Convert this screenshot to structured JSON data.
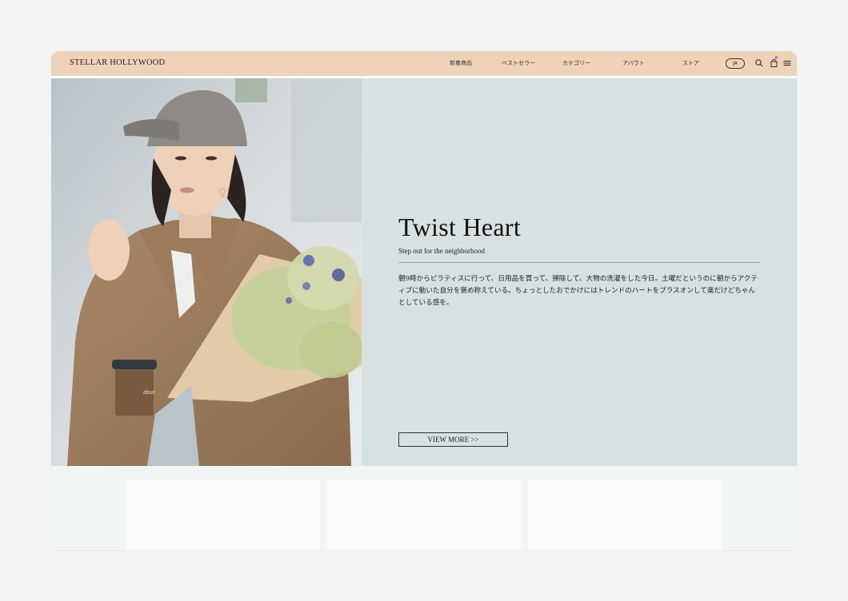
{
  "header": {
    "brand": "STELLAR HOLLYWOOD",
    "nav": [
      {
        "label": "新着商品"
      },
      {
        "label": "ベストセラー"
      },
      {
        "label": "カテゴリー"
      },
      {
        "label": "アバウト"
      },
      {
        "label": "ストア"
      }
    ],
    "language": "JA",
    "cart_count": "0",
    "icons": [
      "search-icon",
      "cart-icon",
      "menu-icon"
    ]
  },
  "hero": {
    "title": "Twist Heart",
    "subtitle": "Step out for the neighborhood",
    "body": "朝9時からピラティスに行って、日用品を買って、掃除して、大物の洗濯をした今日。土曜だというのに朝からアクティブに動いた自分を褒め称えている。ちょっとしたおでかけにはトレンドのハートをプラスオンして楽だけどちゃんとしている感を。",
    "button_label": "VIEW MORE >>",
    "cup_text": "abuc"
  },
  "colors": {
    "header_bg": "#efd3b8",
    "panel_bg": "#d7e1e1",
    "page_bg": "#f4f4f4"
  }
}
